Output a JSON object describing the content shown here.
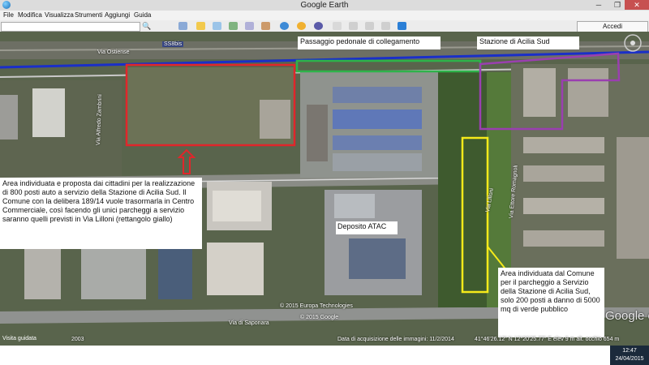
{
  "window": {
    "title": "Google Earth",
    "minimize": "─",
    "maximize": "❐",
    "close": "✕"
  },
  "menu": [
    "File",
    "Modifica",
    "Visualizza",
    "Strumenti",
    "Aggiungi",
    "Guida"
  ],
  "toolbar": {
    "search_button": "🔍",
    "sign_in": "Accedi"
  },
  "map": {
    "labels": {
      "passaggio": "Passaggio pedonale di collegamento",
      "stazione": "Stazione di Acilia Sud",
      "deposito": "Deposito ATAC",
      "area_cittadini": "Area individuata e proposta dai cittadini per la realizzazione di 800 posti auto a servizio della Stazione di Acilia Sud. Il Comune con la delibera 189/14 vuole trasormarla in Centro Commerciale, così facendo gli unici parcheggi a servizio saranno quelli previsti in Via Lilloni (rettangolo giallo)",
      "area_comune": "Area individuata dal Comune per il parcheggio a Servizio della Stazione di Acilia Sud, solo 200 posti a danno di 5000 mq di verde pubblico"
    },
    "roads": {
      "via_ostiense": "Via Ostiense",
      "ss8": "SS8bis",
      "via_saponara": "Via di Saponara",
      "via_lilloni": "Via Lilloni",
      "via_francesco": "Via Ettore Romagnoli",
      "via_left": "Via Alfredo Zambrini"
    },
    "copyright1": "© 2015 Europa Technologies",
    "copyright2": "© 2015 Google",
    "watermark": "Google earth",
    "image_date": "Data di acquisizione delle immagini: 11/2/2014",
    "coords": "41°46'26.12\" N  12°20'25.77\" E  elev  9 m  alt. occhio  654 m",
    "year": "2003"
  },
  "statusbar": {
    "tour": "Visita guidata",
    "time": "12:47",
    "date": "24/04/2015"
  },
  "colors": {
    "red": "#e0262b",
    "green": "#2eb34a",
    "purple": "#9a3fb0",
    "yellow": "#f5ea1a",
    "blue": "#1a2fc8"
  }
}
